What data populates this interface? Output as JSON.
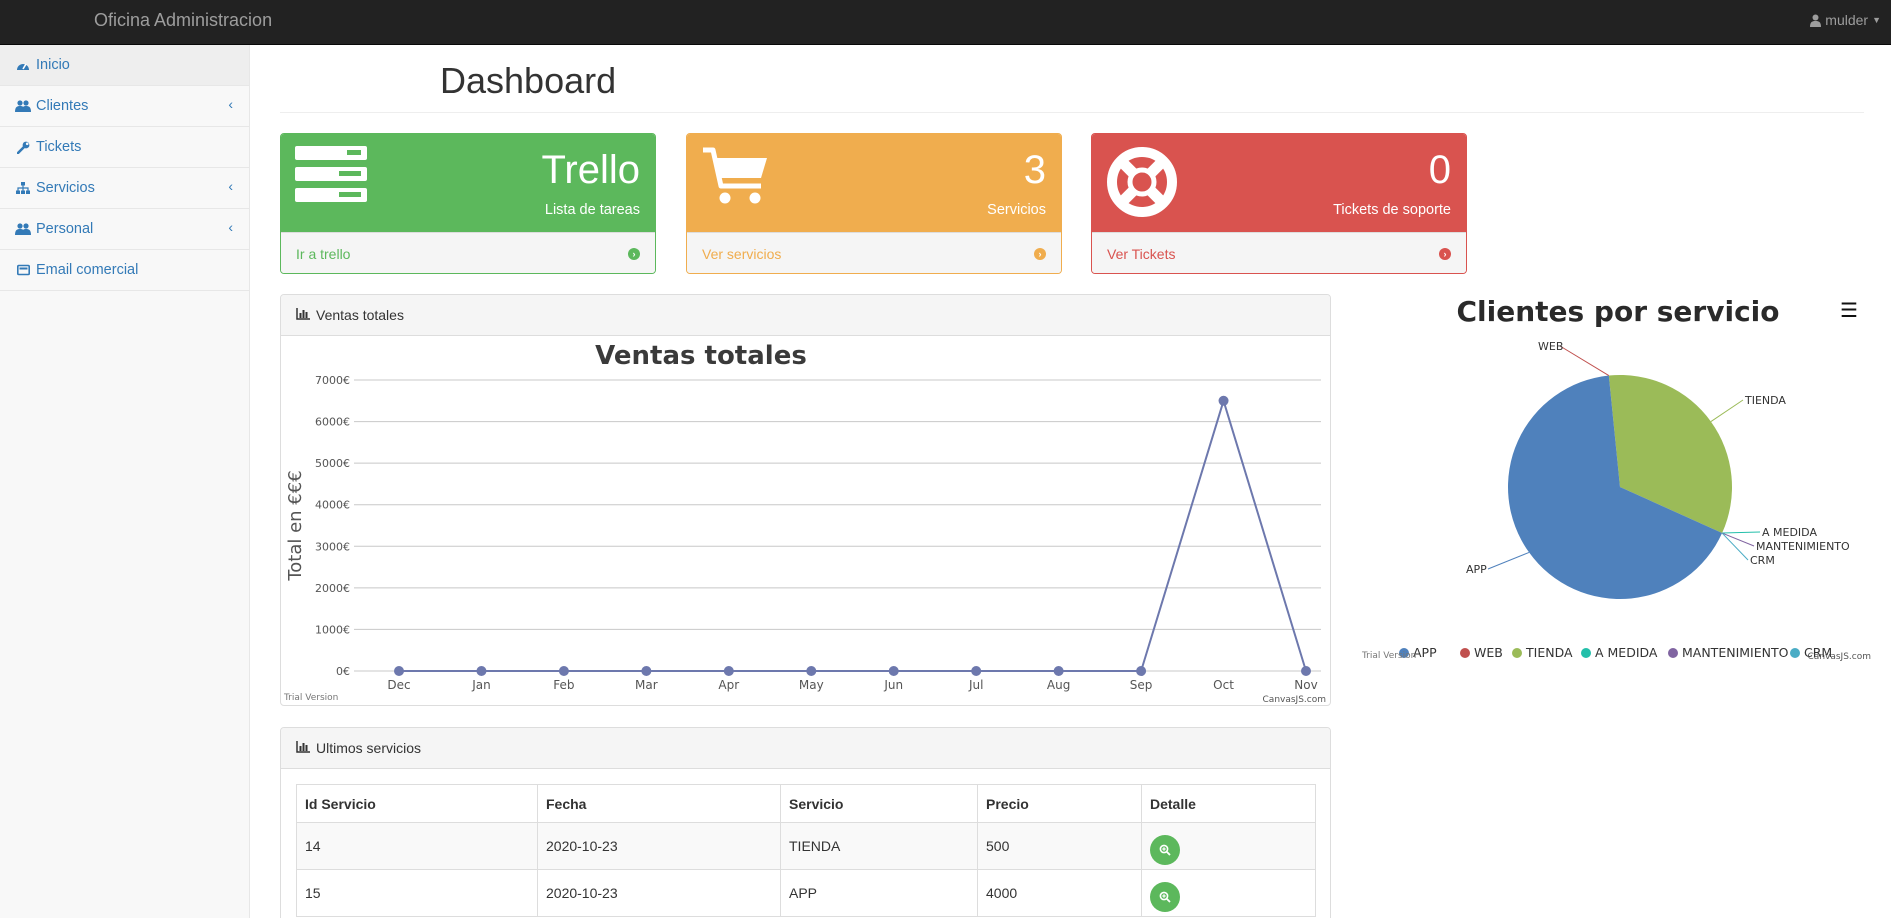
{
  "navbar": {
    "brand": "Oficina Administracion",
    "user": "mulder"
  },
  "sidebar": {
    "items": [
      {
        "label": "Inicio",
        "icon": "dashboard-icon"
      },
      {
        "label": "Clientes",
        "icon": "users-icon"
      },
      {
        "label": "Tickets",
        "icon": "wrench-icon"
      },
      {
        "label": "Servicios",
        "icon": "sitemap-icon"
      },
      {
        "label": "Personal",
        "icon": "users-icon"
      },
      {
        "label": "Email comercial",
        "icon": "email-icon"
      }
    ]
  },
  "page": {
    "title": "Dashboard"
  },
  "stats": [
    {
      "value": "Trello",
      "label": "Lista de tareas",
      "link": "Ir a trello",
      "color": "#5cb85c",
      "icon": "server-icon"
    },
    {
      "value": "3",
      "label": "Servicios",
      "link": "Ver servicios",
      "color": "#f0ad4e",
      "icon": "cart-icon"
    },
    {
      "value": "0",
      "label": "Tickets de soporte",
      "link": "Ver Tickets",
      "color": "#d9534f",
      "icon": "lifebuoy-icon"
    }
  ],
  "sales_panel": {
    "heading": "Ventas totales"
  },
  "services_panel": {
    "heading": "Ultimos servicios",
    "columns": [
      "Id Servicio",
      "Fecha",
      "Servicio",
      "Precio",
      "Detalle"
    ],
    "rows": [
      [
        "14",
        "2020-10-23",
        "TIENDA",
        "500"
      ],
      [
        "15",
        "2020-10-23",
        "APP",
        "4000"
      ]
    ]
  },
  "chart_data": [
    {
      "type": "line",
      "title": "Ventas totales",
      "ylabel": "Total en €€€",
      "xlabel": "",
      "categories": [
        "Dec",
        "Jan",
        "Feb",
        "Mar",
        "Apr",
        "May",
        "Jun",
        "Jul",
        "Aug",
        "Sep",
        "Oct",
        "Nov"
      ],
      "values": [
        0,
        0,
        0,
        0,
        0,
        0,
        0,
        0,
        0,
        0,
        6500,
        0
      ],
      "ylim": [
        0,
        7000
      ],
      "yticks": [
        "0€",
        "1000€",
        "2000€",
        "3000€",
        "4000€",
        "5000€",
        "6000€",
        "7000€"
      ],
      "grid": true,
      "line_color": "#6d78ad",
      "watermark_left": "Trial Version",
      "watermark_right": "CanvasJS.com"
    },
    {
      "type": "pie",
      "title": "Clientes por servicio",
      "categories": [
        "APP",
        "WEB",
        "TIENDA",
        "A MEDIDA",
        "MANTENIMIENTO",
        "CRM"
      ],
      "values": [
        2,
        0,
        1,
        0,
        0,
        0
      ],
      "colors": [
        "#4f81bc",
        "#c0504e",
        "#9bbb58",
        "#23bfaa",
        "#8064a1",
        "#4aacc5"
      ],
      "legend": "bottom",
      "watermark_left": "Trial Version",
      "watermark_right": "CanvasJS.com"
    }
  ]
}
